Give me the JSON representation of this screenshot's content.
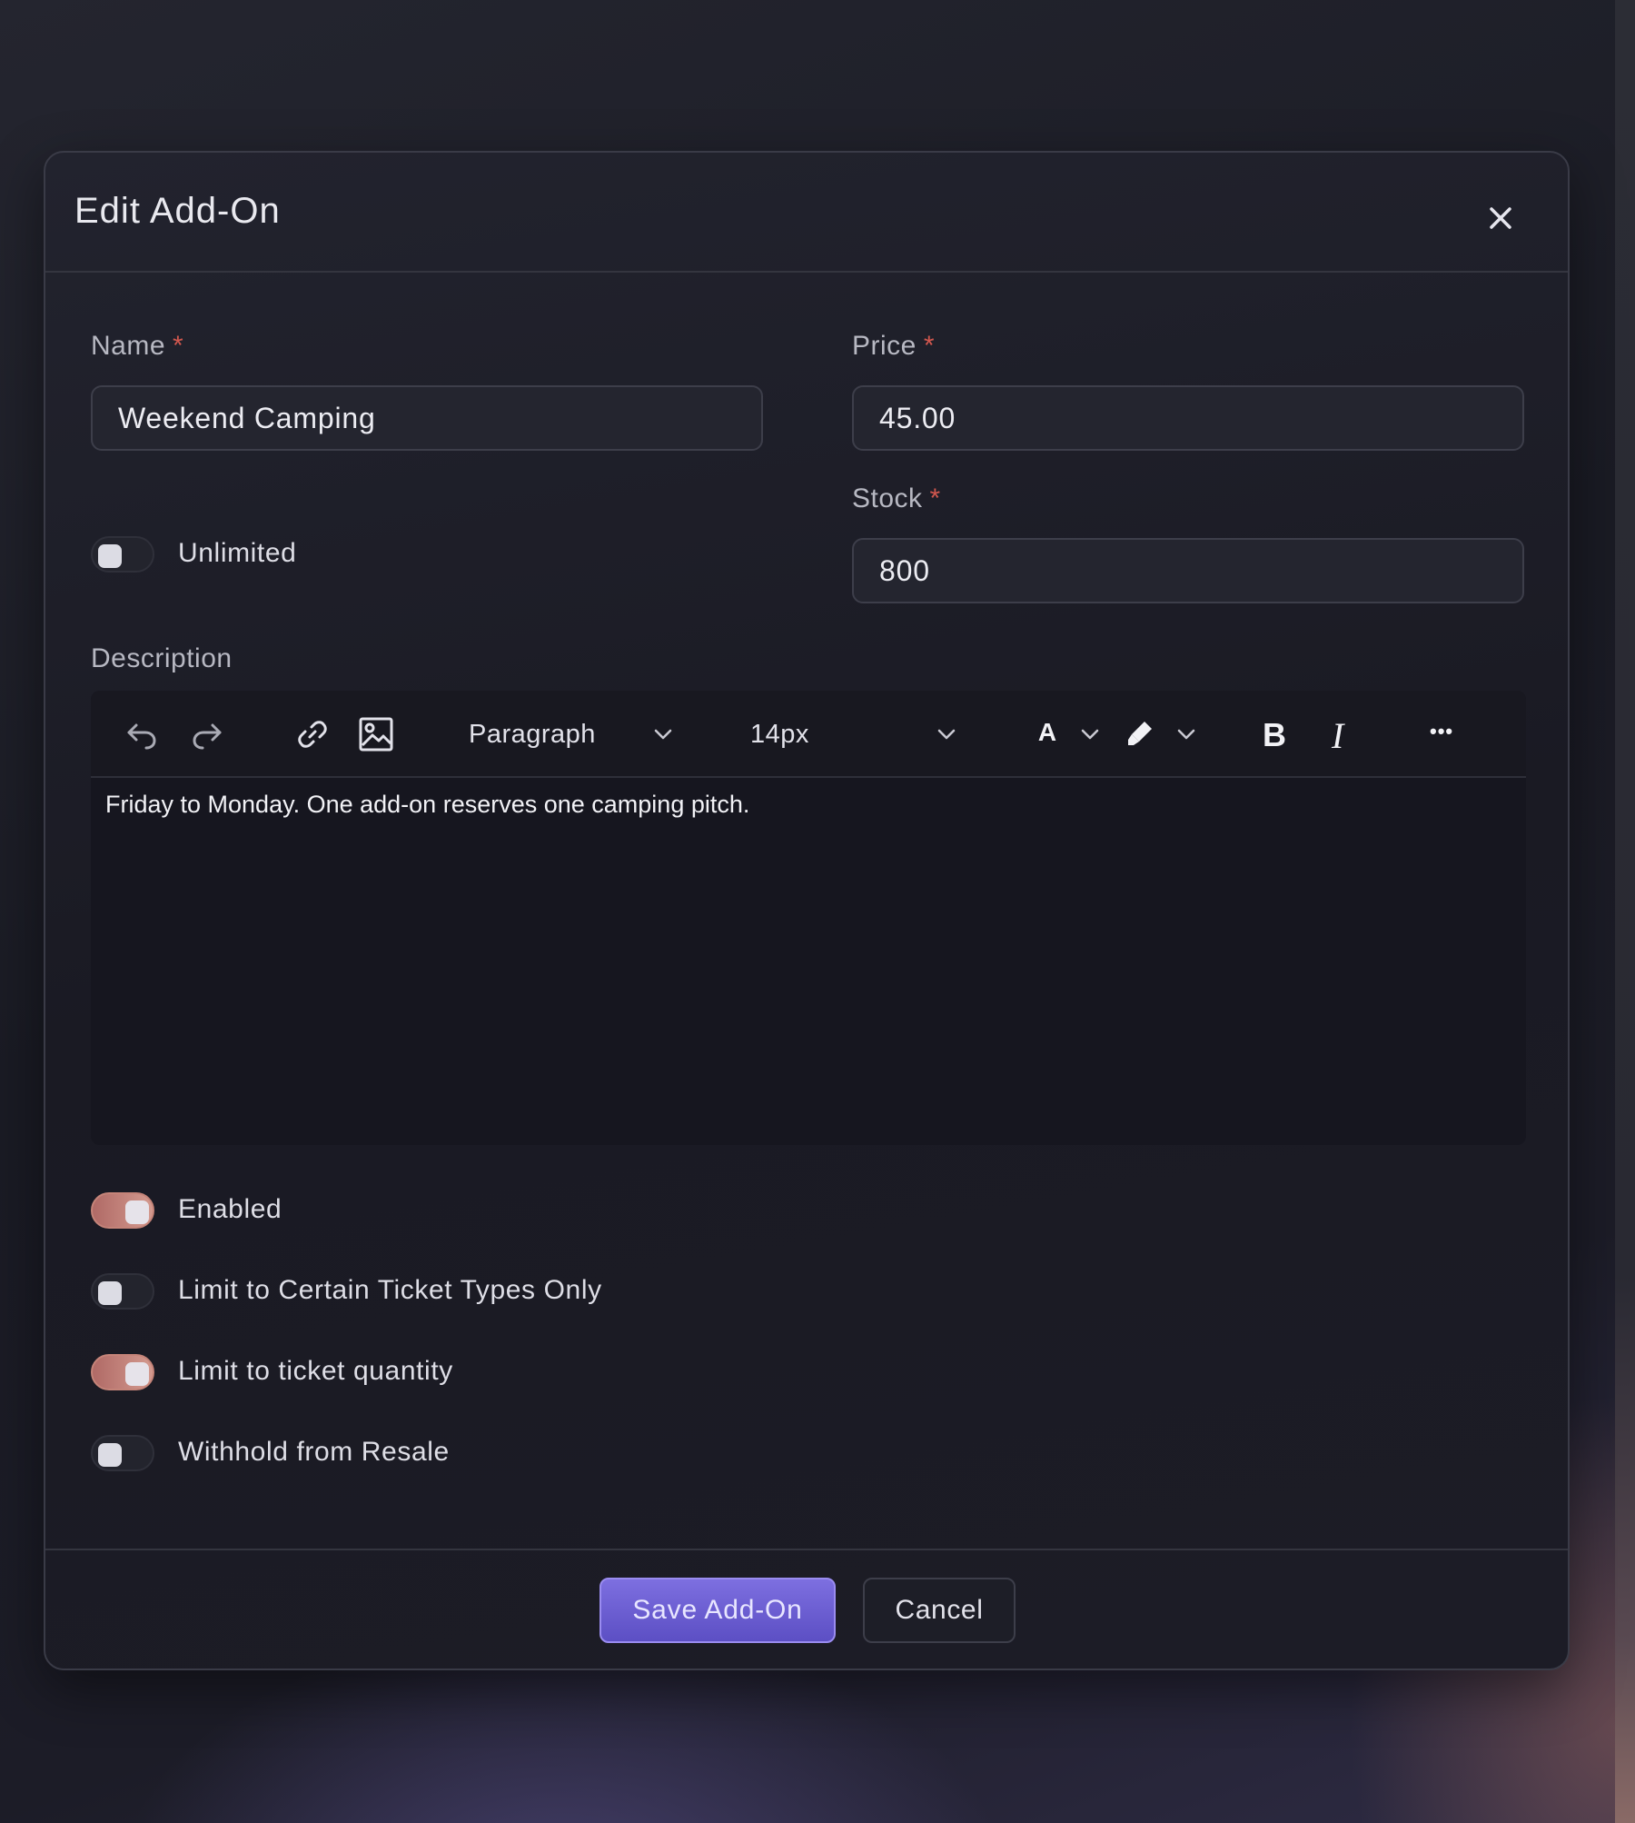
{
  "dialog": {
    "title": "Edit Add-On",
    "close_icon": "close-icon"
  },
  "form": {
    "name": {
      "label": "Name",
      "required_mark": "*",
      "value": "Weekend Camping"
    },
    "price": {
      "label": "Price",
      "required_mark": "*",
      "value": "45.00"
    },
    "stock": {
      "label": "Stock",
      "required_mark": "*",
      "value": "800"
    },
    "unlimited": {
      "label": "Unlimited",
      "checked": false
    },
    "description": {
      "label": "Description",
      "content": "Friday to Monday. One add-on reserves one camping pitch."
    }
  },
  "editor_toolbar": {
    "icons": [
      "undo-icon",
      "redo-icon",
      "link-icon",
      "image-icon",
      "font-color-icon",
      "highlighter-icon",
      "bold-icon",
      "italic-icon",
      "more-icon"
    ],
    "block_format": "Paragraph",
    "font_size": "14px",
    "font_color_glyph": "A",
    "bold_glyph": "B",
    "italic_glyph": "I",
    "more_glyph": "•••"
  },
  "toggles": [
    {
      "label": "Enabled",
      "checked": true
    },
    {
      "label": "Limit to Certain Ticket Types Only",
      "checked": false
    },
    {
      "label": "Limit to ticket quantity",
      "checked": true
    },
    {
      "label": "Withhold from Resale",
      "checked": false
    }
  ],
  "footer": {
    "save_label": "Save Add-On",
    "cancel_label": "Cancel"
  },
  "colors": {
    "accent": "#6a5cd6",
    "toggle_on": "#c27f77",
    "required": "#d1574e",
    "background": "#1c1c26"
  }
}
